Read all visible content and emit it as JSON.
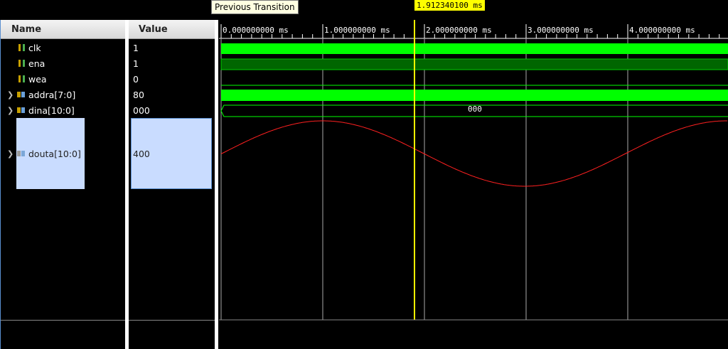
{
  "tooltip": {
    "text": "Previous Transition"
  },
  "cursor": {
    "label": "1.912340100 ms",
    "color": "#ffff00"
  },
  "columns": {
    "name": "Name",
    "value": "Value"
  },
  "signals": [
    {
      "name": "clk",
      "value": "1",
      "icon": "bit-signal-icon",
      "expandable": false
    },
    {
      "name": "ena",
      "value": "1",
      "icon": "bit-signal-icon",
      "expandable": false
    },
    {
      "name": "wea",
      "value": "0",
      "icon": "bit-signal-icon",
      "expandable": false
    },
    {
      "name": "addra[7:0]",
      "value": "80",
      "icon": "bus-signal-icon",
      "expandable": true
    },
    {
      "name": "dina[10:0]",
      "value": "000",
      "icon": "bus-signal-icon",
      "expandable": true
    },
    {
      "name": "douta[10:0]",
      "value": "400",
      "icon": "analog-bus-icon",
      "expandable": true,
      "selected": true
    }
  ],
  "timeline": {
    "ticks": [
      "0.000000000 ms",
      "1.000000000 ms",
      "2.000000000 ms",
      "3.000000000 ms",
      "4.000000000 ms"
    ]
  },
  "waveforms": {
    "dina_bus_value": "000"
  },
  "colors": {
    "wave_green": "#00ff00",
    "wave_dark_green": "#006600",
    "analog_red": "#ff2020",
    "selection": "#c9dcff"
  }
}
